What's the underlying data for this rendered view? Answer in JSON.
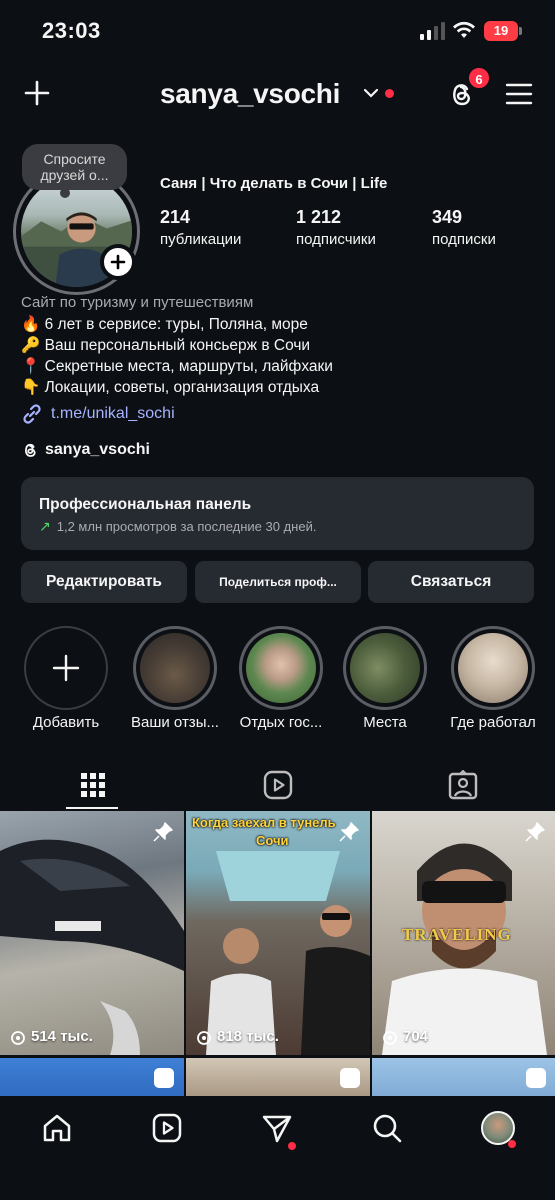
{
  "status_bar": {
    "time": "23:03",
    "battery": "19"
  },
  "header": {
    "username": "sanya_vsochi",
    "threads_badge": "6",
    "colors": {
      "notification": "#ff2d45",
      "link": "#a7b3ff",
      "accent_green": "#4cd964"
    }
  },
  "profile": {
    "bubble": "Спросите друзей о...",
    "full_name": "Саня | Что делать в Сочи | Life",
    "stats": [
      {
        "value": "214",
        "label": "публикации"
      },
      {
        "value": "1 212",
        "label": "подписчики"
      },
      {
        "value": "349",
        "label": "подписки"
      }
    ],
    "category": "Сайт по туризму и путешествиям",
    "bio": [
      {
        "emoji": "🔥",
        "text": "6 лет в сервисе: туры, Поляна, море"
      },
      {
        "emoji": "🔑",
        "text": "Ваш персональный консьерж в Сочи"
      },
      {
        "emoji": "📍",
        "text": "Секретные места, маршруты, лайфхаки"
      },
      {
        "emoji": "👇",
        "text": "Локации, советы, организация отдыха"
      }
    ],
    "link": "t.me/unikal_sochi",
    "threads_handle": "sanya_vsochi"
  },
  "pro_panel": {
    "title": "Профессиональная панель",
    "subtitle": "1,2 млн просмотров за последние 30 дней."
  },
  "actions": {
    "edit": "Редактировать",
    "share": "Поделиться проф...",
    "contact": "Связаться"
  },
  "highlights": [
    {
      "label": "Добавить",
      "icon": "plus-icon"
    },
    {
      "label": "Ваши отзы..."
    },
    {
      "label": "Отдых гос..."
    },
    {
      "label": "Места"
    },
    {
      "label": "Где работал"
    }
  ],
  "tabs": [
    {
      "name": "grid",
      "icon": "grid-icon"
    },
    {
      "name": "reels",
      "icon": "reels-icon"
    },
    {
      "name": "tagged",
      "icon": "tagged-icon"
    }
  ],
  "posts": [
    {
      "views": "514 тыс.",
      "pinned": true
    },
    {
      "views": "818 тыс.",
      "pinned": true,
      "caption_top": "Когда заехал в тунель",
      "caption_sub": "Сочи"
    },
    {
      "views": "704",
      "pinned": true,
      "caption_mid": "TRAVELING"
    }
  ],
  "bottom_nav": [
    {
      "name": "home",
      "icon": "home-icon"
    },
    {
      "name": "reels",
      "icon": "reels-icon"
    },
    {
      "name": "direct",
      "icon": "send-icon"
    },
    {
      "name": "search",
      "icon": "search-icon"
    },
    {
      "name": "profile",
      "icon": "avatar"
    }
  ]
}
